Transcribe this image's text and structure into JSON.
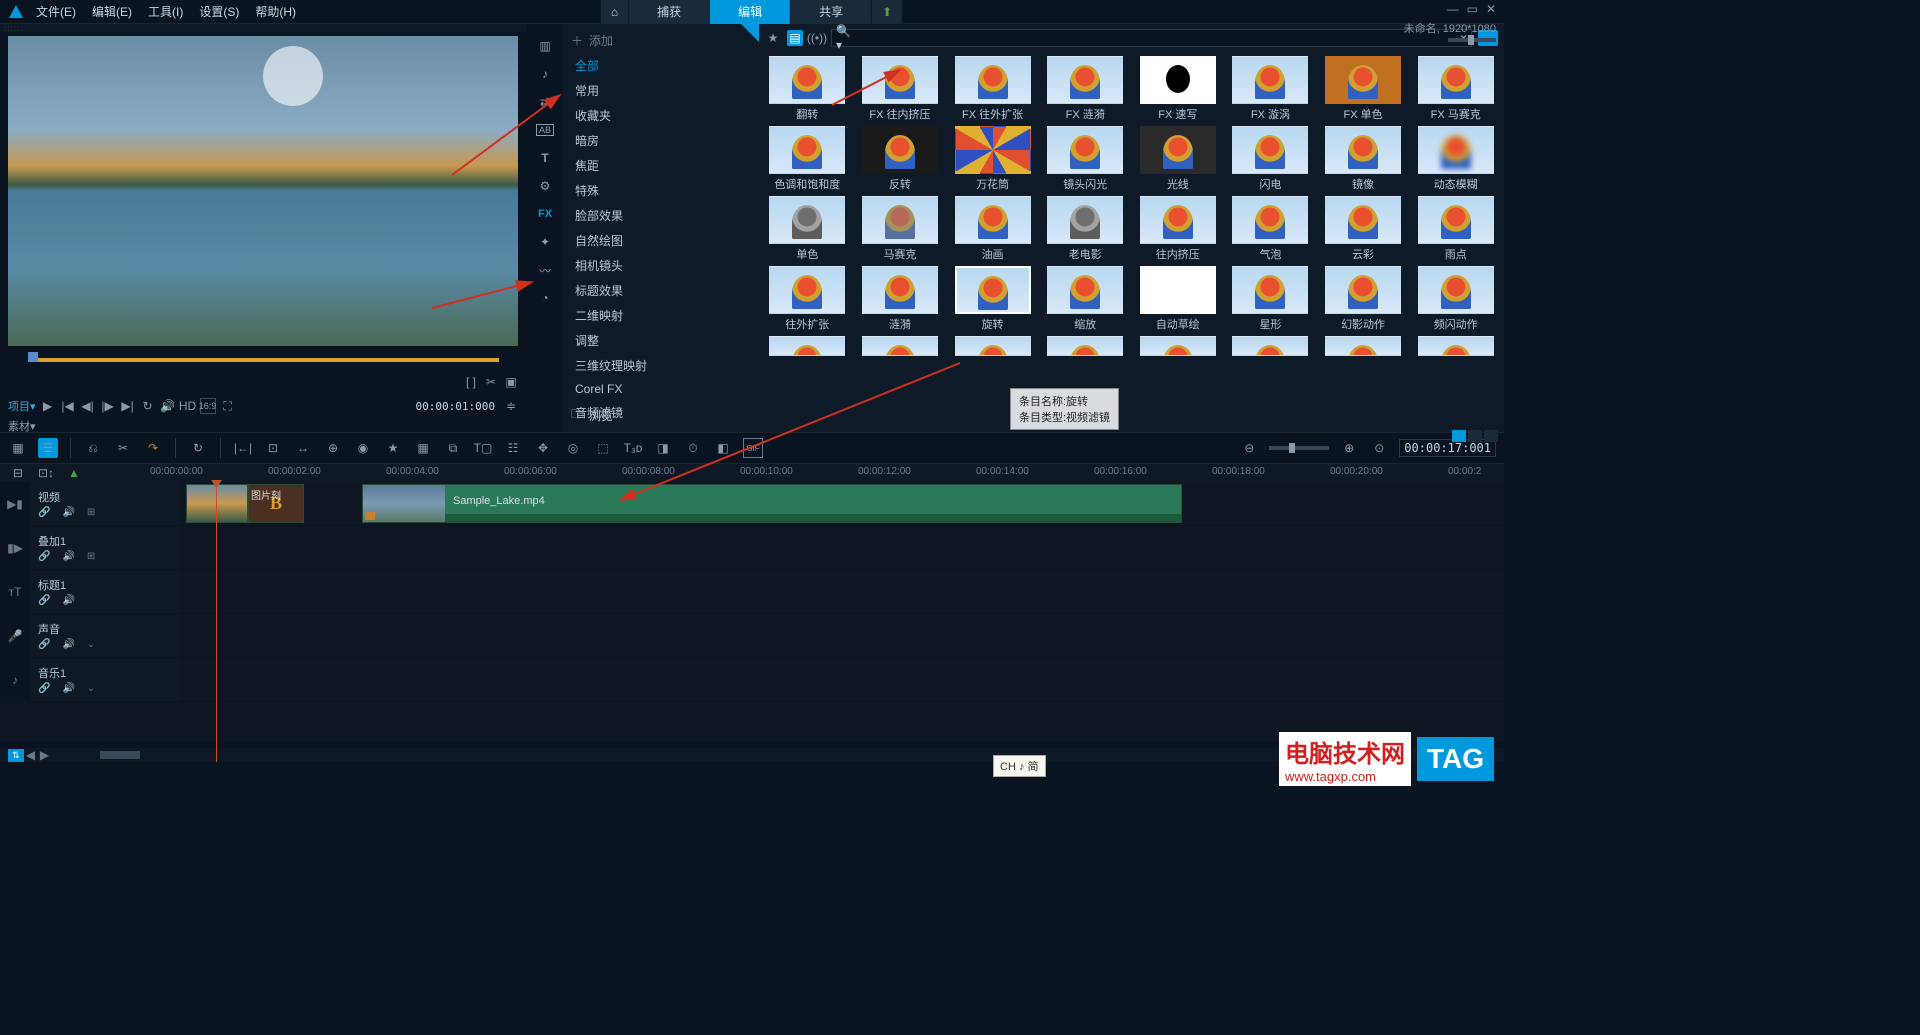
{
  "menubar": {
    "items": [
      "文件(E)",
      "编辑(E)",
      "工具(I)",
      "设置(S)",
      "帮助(H)"
    ]
  },
  "topTabs": {
    "home": "⌂",
    "capture": "捕获",
    "edit": "编辑",
    "share": "共享"
  },
  "docInfo": "未命名, 1920*1080",
  "preview": {
    "projLabel": "项目▾",
    "matLabel": "素材▾",
    "hd": "HD",
    "aspect": "16:9",
    "timecode": "00:00:01:000",
    "delta": "≑"
  },
  "library": {
    "addLabel": "添加",
    "browse": "浏览",
    "categories": [
      "全部",
      "常用",
      "收藏夹",
      "暗房",
      "焦距",
      "特殊",
      "脸部效果",
      "自然绘图",
      "相机镜头",
      "标题效果",
      "二维映射",
      "调整",
      "三维纹理映射",
      "Corel FX",
      "音频滤镜"
    ],
    "activeCategory": 0
  },
  "fx": {
    "items": [
      {
        "label": "翻转",
        "cls": ""
      },
      {
        "label": "FX 往内挤压",
        "cls": ""
      },
      {
        "label": "FX 往外扩张",
        "cls": ""
      },
      {
        "label": "FX 涟漪",
        "cls": ""
      },
      {
        "label": "FX 速写",
        "cls": "white-bg"
      },
      {
        "label": "FX 漩涡",
        "cls": ""
      },
      {
        "label": "FX 单色",
        "cls": "orange"
      },
      {
        "label": "FX 马赛克",
        "cls": ""
      },
      {
        "label": "色调和饱和度",
        "cls": ""
      },
      {
        "label": "反转",
        "cls": "dark"
      },
      {
        "label": "万花筒",
        "cls": "pattern"
      },
      {
        "label": "镜头闪光",
        "cls": ""
      },
      {
        "label": "光线",
        "cls": "dark2"
      },
      {
        "label": "闪电",
        "cls": ""
      },
      {
        "label": "镜像",
        "cls": ""
      },
      {
        "label": "动态模糊",
        "cls": "blur"
      },
      {
        "label": "单色",
        "cls": "gray"
      },
      {
        "label": "马赛克",
        "cls": "pix"
      },
      {
        "label": "油画",
        "cls": ""
      },
      {
        "label": "老电影",
        "cls": "gray"
      },
      {
        "label": "往内挤压",
        "cls": ""
      },
      {
        "label": "气泡",
        "cls": ""
      },
      {
        "label": "云彩",
        "cls": ""
      },
      {
        "label": "雨点",
        "cls": ""
      },
      {
        "label": "往外扩张",
        "cls": ""
      },
      {
        "label": "涟漪",
        "cls": ""
      },
      {
        "label": "旋转",
        "cls": "selected"
      },
      {
        "label": "缩放",
        "cls": ""
      },
      {
        "label": "自动草绘",
        "cls": "blank"
      },
      {
        "label": "星形",
        "cls": ""
      },
      {
        "label": "幻影动作",
        "cls": ""
      },
      {
        "label": "频闪动作",
        "cls": ""
      }
    ],
    "partialRow": 8
  },
  "tooltip": {
    "name": "条目名称:旋转",
    "type": "条目类型:视频滤镜"
  },
  "timeline": {
    "timeDisplay": "00:00:17:001",
    "ruler": [
      "00:00:00:00",
      "00:00:02:00",
      "00:00:04:00",
      "00:00:06:00",
      "00:00:08:00",
      "00:00:10:00",
      "00:00:12:00",
      "00:00:14:00",
      "00:00:16:00",
      "00:00:18:00",
      "00:00:20:00",
      "00:00:2"
    ],
    "tracks": {
      "video": "视频",
      "overlay": "叠加1",
      "title": "标题1",
      "voice": "声音",
      "music": "音乐1"
    },
    "clips": {
      "bLabel": "图片刻",
      "bLetter": "B",
      "videoName": "Sample_Lake.mp4"
    }
  },
  "ime": "CH ♪ 简",
  "watermark": {
    "cn": "电脑技术网",
    "url": "www.tagxp.com",
    "tag": "TAG"
  }
}
